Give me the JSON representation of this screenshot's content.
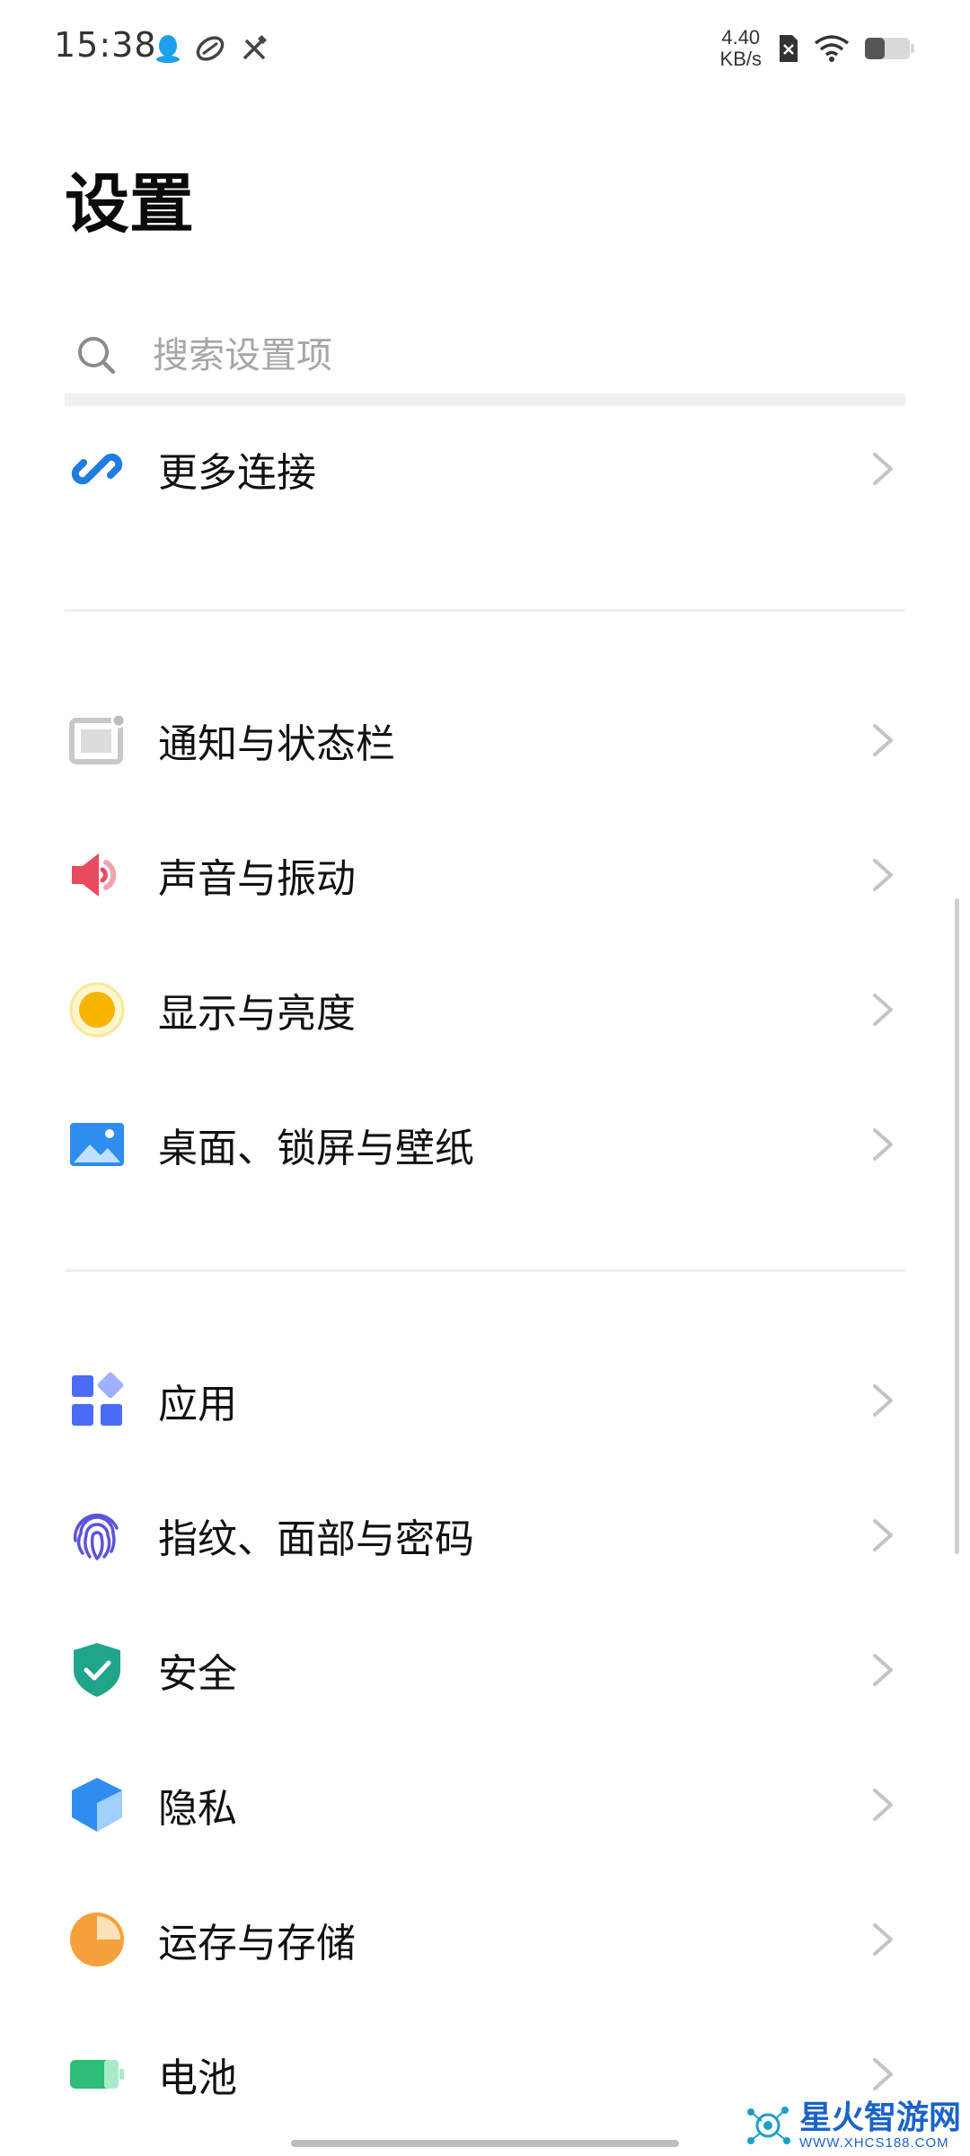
{
  "status_bar": {
    "time": "15:38",
    "net_speed_value": "4.40",
    "net_speed_unit": "KB/s",
    "left_icons": [
      "qq-icon",
      "rugby-ball-icon",
      "tools-icon"
    ],
    "right_icons": [
      "sim-disabled-icon",
      "wifi-icon",
      "battery-icon"
    ]
  },
  "page": {
    "title": "设置"
  },
  "search": {
    "placeholder": "搜索设置项"
  },
  "groups": [
    {
      "items": [
        {
          "label": "更多连接",
          "icon": "link-icon",
          "color": "#1f7ce0"
        }
      ]
    },
    {
      "items": [
        {
          "label": "通知与状态栏",
          "icon": "notification-icon",
          "color": "#bdbdbd"
        },
        {
          "label": "声音与振动",
          "icon": "sound-icon",
          "color": "#e84a5f"
        },
        {
          "label": "显示与亮度",
          "icon": "brightness-icon",
          "color": "#f7b500"
        },
        {
          "label": "桌面、锁屏与壁纸",
          "icon": "wallpaper-icon",
          "color": "#2f8df0"
        }
      ]
    },
    {
      "items": [
        {
          "label": "应用",
          "icon": "apps-icon",
          "color": "#4a6cf7"
        },
        {
          "label": "指纹、面部与密码",
          "icon": "fingerprint-icon",
          "color": "#5b54d8"
        },
        {
          "label": "安全",
          "icon": "shield-icon",
          "color": "#1fa589"
        },
        {
          "label": "隐私",
          "icon": "privacy-cube-icon",
          "color": "#2f8df0"
        },
        {
          "label": "运存与存储",
          "icon": "storage-pie-icon",
          "color": "#f5a03a"
        },
        {
          "label": "电池",
          "icon": "battery-green-icon",
          "color": "#2dbd76"
        }
      ]
    }
  ],
  "watermark": {
    "title": "星火智游网",
    "url": "WWW.XHCS188.COM"
  }
}
